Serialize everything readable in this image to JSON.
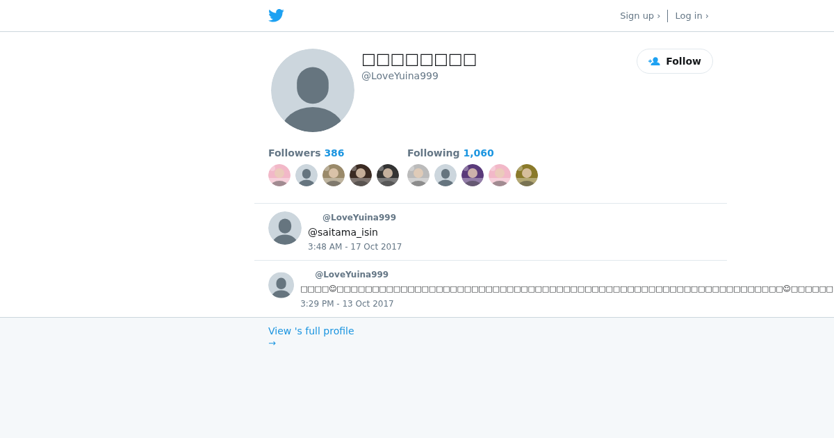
{
  "header": {
    "links": [
      {
        "label": "Sign up ›"
      },
      {
        "label": "Log in ›"
      }
    ]
  },
  "profile": {
    "name": "□□□□□□□□",
    "handle": "@LoveYuina999",
    "follow_button": "Follow"
  },
  "stats": [
    {
      "label": "Followers",
      "count": "386",
      "avatars": [
        {
          "kind": "picture"
        },
        {
          "kind": "default"
        },
        {
          "kind": "picture"
        },
        {
          "kind": "picture"
        },
        {
          "kind": "picture"
        }
      ]
    },
    {
      "label": "Following",
      "count": "1,060",
      "avatars": [
        {
          "kind": "picture"
        },
        {
          "kind": "default"
        },
        {
          "kind": "picture"
        },
        {
          "kind": "picture"
        },
        {
          "kind": "picture"
        }
      ]
    }
  ],
  "tweets": [
    {
      "handle": "@LoveYuina999",
      "text": "@saitama_isin",
      "time": "3:48 AM - 17 Oct 2017"
    },
    {
      "handle": "@LoveYuina999",
      "text": "□□□□☺□□□□□□□□□□□□□□□□□□□□□□□□□□□□□□□□□□□□□□□□□□□□□□□□□□□□□□□□□□□□□□□☺□□□□□□",
      "time": "3:29 PM - 13 Oct 2017"
    }
  ],
  "footer": {
    "link": "View 's full profile",
    "arrow": "→"
  }
}
